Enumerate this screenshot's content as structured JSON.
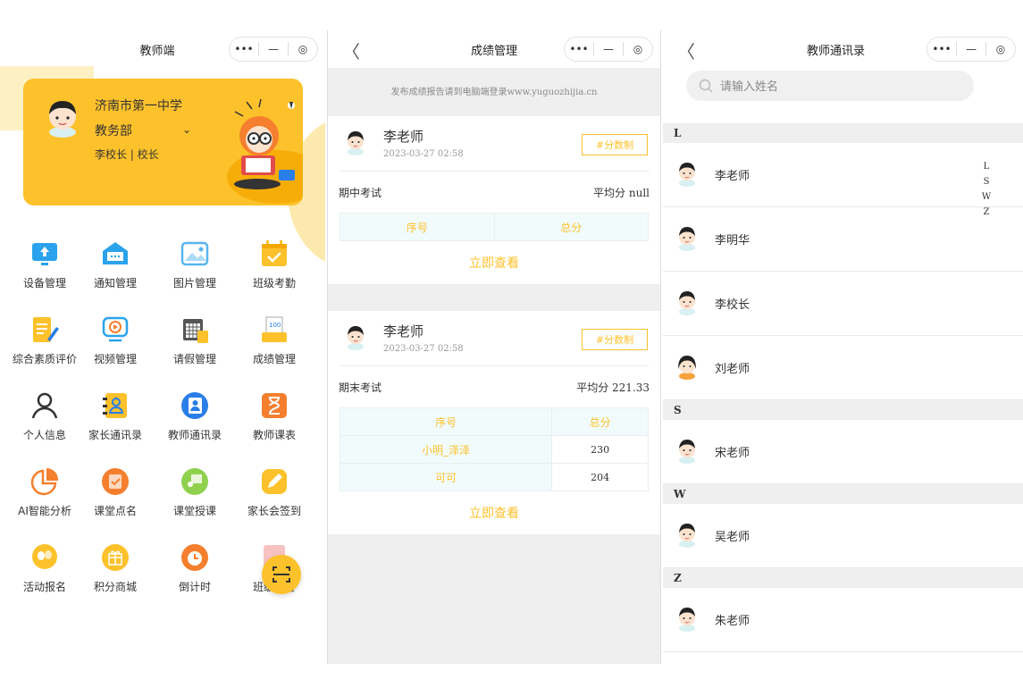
{
  "capsule": {
    "more": "•••",
    "min": "—",
    "close": "◎"
  },
  "p1": {
    "title": "教师端",
    "school": "济南市第一中学",
    "dept": "教务部",
    "dept_arrow": "⌄",
    "role": "李校长 | 校长",
    "grid": [
      {
        "label": "设备管理",
        "icon": "upload-screen-icon",
        "color": "#2aa3ec"
      },
      {
        "label": "通知管理",
        "icon": "notice-mail-icon",
        "color": "#2aa3ec"
      },
      {
        "label": "图片管理",
        "icon": "image-icon",
        "color": "#59b5ef"
      },
      {
        "label": "班级考勤",
        "icon": "calendar-check-icon",
        "color": "#fdc12b"
      },
      {
        "label": "综合素质评价",
        "icon": "edit-doc-icon",
        "color": "#fdc12b"
      },
      {
        "label": "视频管理",
        "icon": "video-icon",
        "color": "#2aa3ec"
      },
      {
        "label": "请假管理",
        "icon": "leave-calendar-icon",
        "color": "#fdc12b"
      },
      {
        "label": "成绩管理",
        "icon": "score-paper-icon",
        "color": "#fdc12b"
      },
      {
        "label": "个人信息",
        "icon": "person-icon",
        "color": "#333333"
      },
      {
        "label": "家长通讯录",
        "icon": "parent-contacts-icon",
        "color": "#fdc12b"
      },
      {
        "label": "教师通讯录",
        "icon": "teacher-contacts-icon",
        "color": "#2a7ee8"
      },
      {
        "label": "教师课表",
        "icon": "hourglass-icon",
        "color": "#f57f2e"
      },
      {
        "label": "AI智能分析",
        "icon": "pie-chart-icon",
        "color": "#f57f2e"
      },
      {
        "label": "课堂点名",
        "icon": "rollcall-icon",
        "color": "#f57f2e"
      },
      {
        "label": "课堂授课",
        "icon": "teaching-icon",
        "color": "#8fd14f"
      },
      {
        "label": "家长会签到",
        "icon": "pencil-sign-icon",
        "color": "#fdc12b"
      },
      {
        "label": "活动报名",
        "icon": "balloon-icon",
        "color": "#fdc12b"
      },
      {
        "label": "积分商城",
        "icon": "gift-icon",
        "color": "#fdc12b"
      },
      {
        "label": "倒计时",
        "icon": "alarm-clock-icon",
        "color": "#f57f2e"
      },
      {
        "label": "班级德育",
        "icon": "badge-icon",
        "color": "#f29a9a"
      }
    ]
  },
  "p2": {
    "title": "成绩管理",
    "back": "〈",
    "notice": "发布成绩报告请到电脑端登录www.yuguozhijia.cn",
    "cards": [
      {
        "teacher": "李老师",
        "time": "2023-03-27 02:58",
        "tag": "#分数制",
        "exam": "期中考试",
        "avg": "平均分 null",
        "head": [
          "序号",
          "总分"
        ],
        "rows": [],
        "view": "立即查看"
      },
      {
        "teacher": "李老师",
        "time": "2023-03-27 02:58",
        "tag": "#分数制",
        "exam": "期末考试",
        "avg": "平均分 221.33",
        "head": [
          "序号",
          "总分"
        ],
        "rows": [
          [
            "小明_泽泽",
            "230"
          ],
          [
            "可可",
            "204"
          ]
        ],
        "view": "立即查看"
      }
    ]
  },
  "p3": {
    "title": "教师通讯录",
    "back": "〈",
    "search_placeholder": "请输入姓名",
    "sections": [
      {
        "letter": "L",
        "names": [
          "李老师",
          "李明华",
          "李校长",
          "刘老师"
        ]
      },
      {
        "letter": "S",
        "names": [
          "宋老师"
        ]
      },
      {
        "letter": "W",
        "names": [
          "吴老师"
        ]
      },
      {
        "letter": "Z",
        "names": [
          "朱老师"
        ]
      }
    ],
    "index": [
      "L",
      "S",
      "W",
      "Z"
    ]
  }
}
